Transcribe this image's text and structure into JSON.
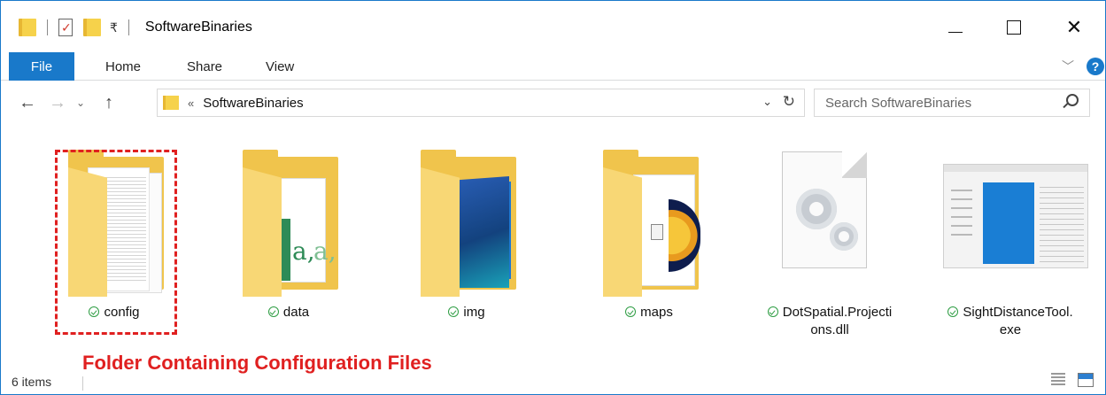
{
  "window": {
    "title": "SoftwareBinaries",
    "dropdown_glyph": "₹"
  },
  "ribbon": {
    "tabs": [
      {
        "label": "File"
      },
      {
        "label": "Home"
      },
      {
        "label": "Share"
      },
      {
        "label": "View"
      }
    ],
    "help_label": "?"
  },
  "address": {
    "chevron": "«",
    "path": "SoftwareBinaries"
  },
  "search": {
    "placeholder": "Search SoftwareBinaries"
  },
  "items": [
    {
      "label": "config",
      "type": "folder",
      "icon": "folder-icon"
    },
    {
      "label": "data",
      "type": "folder",
      "icon": "folder-icon"
    },
    {
      "label": "img",
      "type": "folder",
      "icon": "folder-icon"
    },
    {
      "label": "maps",
      "type": "folder",
      "icon": "folder-icon"
    },
    {
      "label": "DotSpatial.Projecti\nons.dll",
      "type": "dll",
      "icon": "dll-file-icon"
    },
    {
      "label": "SightDistanceTool.\nexe",
      "type": "exe",
      "icon": "exe-file-icon"
    }
  ],
  "annotation": {
    "text": "Folder Containing Configuration Files",
    "color": "#e02020"
  },
  "status": {
    "item_count": "6 items"
  },
  "colors": {
    "accent": "#1979ca",
    "sync_green": "#2e9d43",
    "folder": "#f0c44c"
  }
}
